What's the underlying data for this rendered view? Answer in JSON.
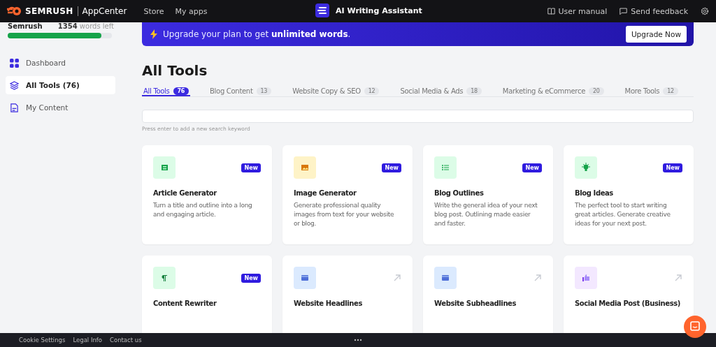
{
  "topbar": {
    "brand": "SEMRUSH",
    "brand_sub": "AppCenter",
    "nav": [
      "Store",
      "My apps"
    ],
    "app_title": "AI Writing Assistant",
    "links": [
      {
        "kind": "manual",
        "label": "User manual"
      },
      {
        "kind": "feedback",
        "label": "Send feedback"
      }
    ]
  },
  "sidebar": {
    "account": "Semrush",
    "words_count": "1354",
    "words_label": "words left",
    "level": 0.9,
    "items": [
      {
        "kind": "dashboard",
        "label": "Dashboard",
        "selected": false
      },
      {
        "kind": "tools",
        "label": "All Tools (76)",
        "selected": true
      },
      {
        "kind": "content",
        "label": "My Content",
        "selected": false
      }
    ]
  },
  "banner": {
    "text": "Upgrade your plan to get **unlimited words**.",
    "button": "Upgrade Now"
  },
  "heading": "All Tools",
  "tabs": [
    {
      "label": "All Tools",
      "count": "76",
      "selected": true
    },
    {
      "label": "Blog Content",
      "count": "13",
      "selected": false
    },
    {
      "label": "Website Copy & SEO",
      "count": "12",
      "selected": false
    },
    {
      "label": "Social Media & Ads",
      "count": "18",
      "selected": false
    },
    {
      "label": "Marketing & eCommerce",
      "count": "20",
      "selected": false
    },
    {
      "label": "More Tools",
      "count": "12",
      "selected": false
    }
  ],
  "search": {
    "hint": "Press enter to add a new search keyword"
  },
  "cards": [
    {
      "kind": "article",
      "title": "Article Generator",
      "description": "Turn a title and outline into a long and engaging article.",
      "badge": "New"
    },
    {
      "kind": "image",
      "title": "Image Generator",
      "description": "Generate professional quality images from text for your website or blog.",
      "badge": "New"
    },
    {
      "kind": "list",
      "title": "Blog Outlines",
      "description": "Write the general idea of your next blog post. Outlining made easier and faster.",
      "badge": "New"
    },
    {
      "kind": "idea",
      "title": "Blog Ideas",
      "description": "The perfect tool to start writing great articles. Generate creative ideas for your next post.",
      "badge": "New"
    },
    {
      "kind": "paragraph",
      "title": "Content Rewriter",
      "badge": "New"
    },
    {
      "kind": "web",
      "title": "Website Headlines"
    },
    {
      "kind": "web",
      "title": "Website Subheadlines"
    },
    {
      "kind": "social",
      "title": "Social Media Post (Business)"
    }
  ],
  "footer": {
    "links": [
      "Cookie Settings",
      "Legal Info",
      "Contact us"
    ]
  }
}
